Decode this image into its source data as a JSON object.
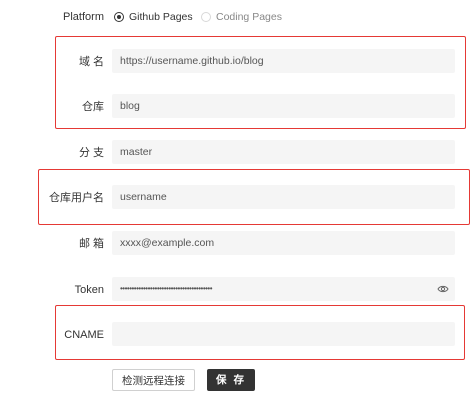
{
  "platform": {
    "label": "Platform",
    "options": [
      {
        "label": "Github Pages",
        "selected": true
      },
      {
        "label": "Coding Pages",
        "selected": false
      }
    ]
  },
  "fields": {
    "domain": {
      "label": "域 名",
      "value": "https://username.github.io/blog"
    },
    "repo": {
      "label": "仓库",
      "value": "blog"
    },
    "branch": {
      "label": "分 支",
      "value": "master"
    },
    "repo_user": {
      "label": "仓库用户名",
      "value": "username"
    },
    "email": {
      "label": "邮 箱",
      "value": "xxxx@example.com"
    },
    "token": {
      "label": "Token",
      "value": "••••••••••••••••••••••••••••••••••••••••",
      "icon": "eye-icon"
    },
    "cname": {
      "label": "CNAME",
      "value": ""
    }
  },
  "buttons": {
    "check_label": "检测远程连接",
    "save_label": "保 存"
  },
  "colors": {
    "highlight_border": "#e53935",
    "field_bg": "#f5f5f5",
    "primary_button": "#333333"
  }
}
